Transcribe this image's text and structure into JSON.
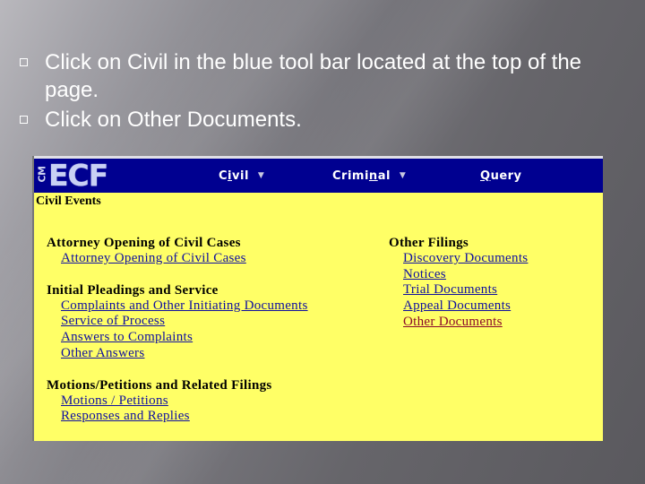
{
  "slide": {
    "bullets": [
      "Click on Civil in the blue tool bar located at the top of the page.",
      "Click on Other Documents."
    ],
    "bullet_icon": "hollow-square-bullet"
  },
  "ecf": {
    "logo": {
      "prefix": "CM",
      "text": "ECF"
    },
    "menu": [
      {
        "pre": "C",
        "ul": "i",
        "post": "vil",
        "caret": "▼",
        "has_dropdown": true
      },
      {
        "pre": "Crimi",
        "ul": "n",
        "post": "al",
        "caret": "▼",
        "has_dropdown": true
      },
      {
        "pre": "",
        "ul": "Q",
        "post": "uery",
        "caret": "",
        "has_dropdown": false
      }
    ],
    "section_title": "Civil Events",
    "colors": {
      "toolbar": "#000090",
      "panel": "#ffff66",
      "link": "#1010a0",
      "visited_link": "#8b0a2a"
    },
    "left_groups": [
      {
        "title": "Attorney Opening of Civil Cases",
        "links": [
          "Attorney Opening of Civil Cases"
        ]
      },
      {
        "title": "Initial Pleadings and Service",
        "links": [
          "Complaints and Other Initiating Documents",
          "Service of Process",
          "Answers to Complaints",
          "Other Answers"
        ]
      },
      {
        "title": "Motions/Petitions and Related Filings",
        "links": [
          "Motions / Petitions",
          "Responses and Replies"
        ]
      }
    ],
    "right_groups": [
      {
        "title": "Other Filings",
        "links": [
          "Discovery Documents",
          "Notices",
          "Trial Documents",
          "Appeal Documents",
          "Other Documents"
        ],
        "visited_index": 4
      }
    ]
  }
}
